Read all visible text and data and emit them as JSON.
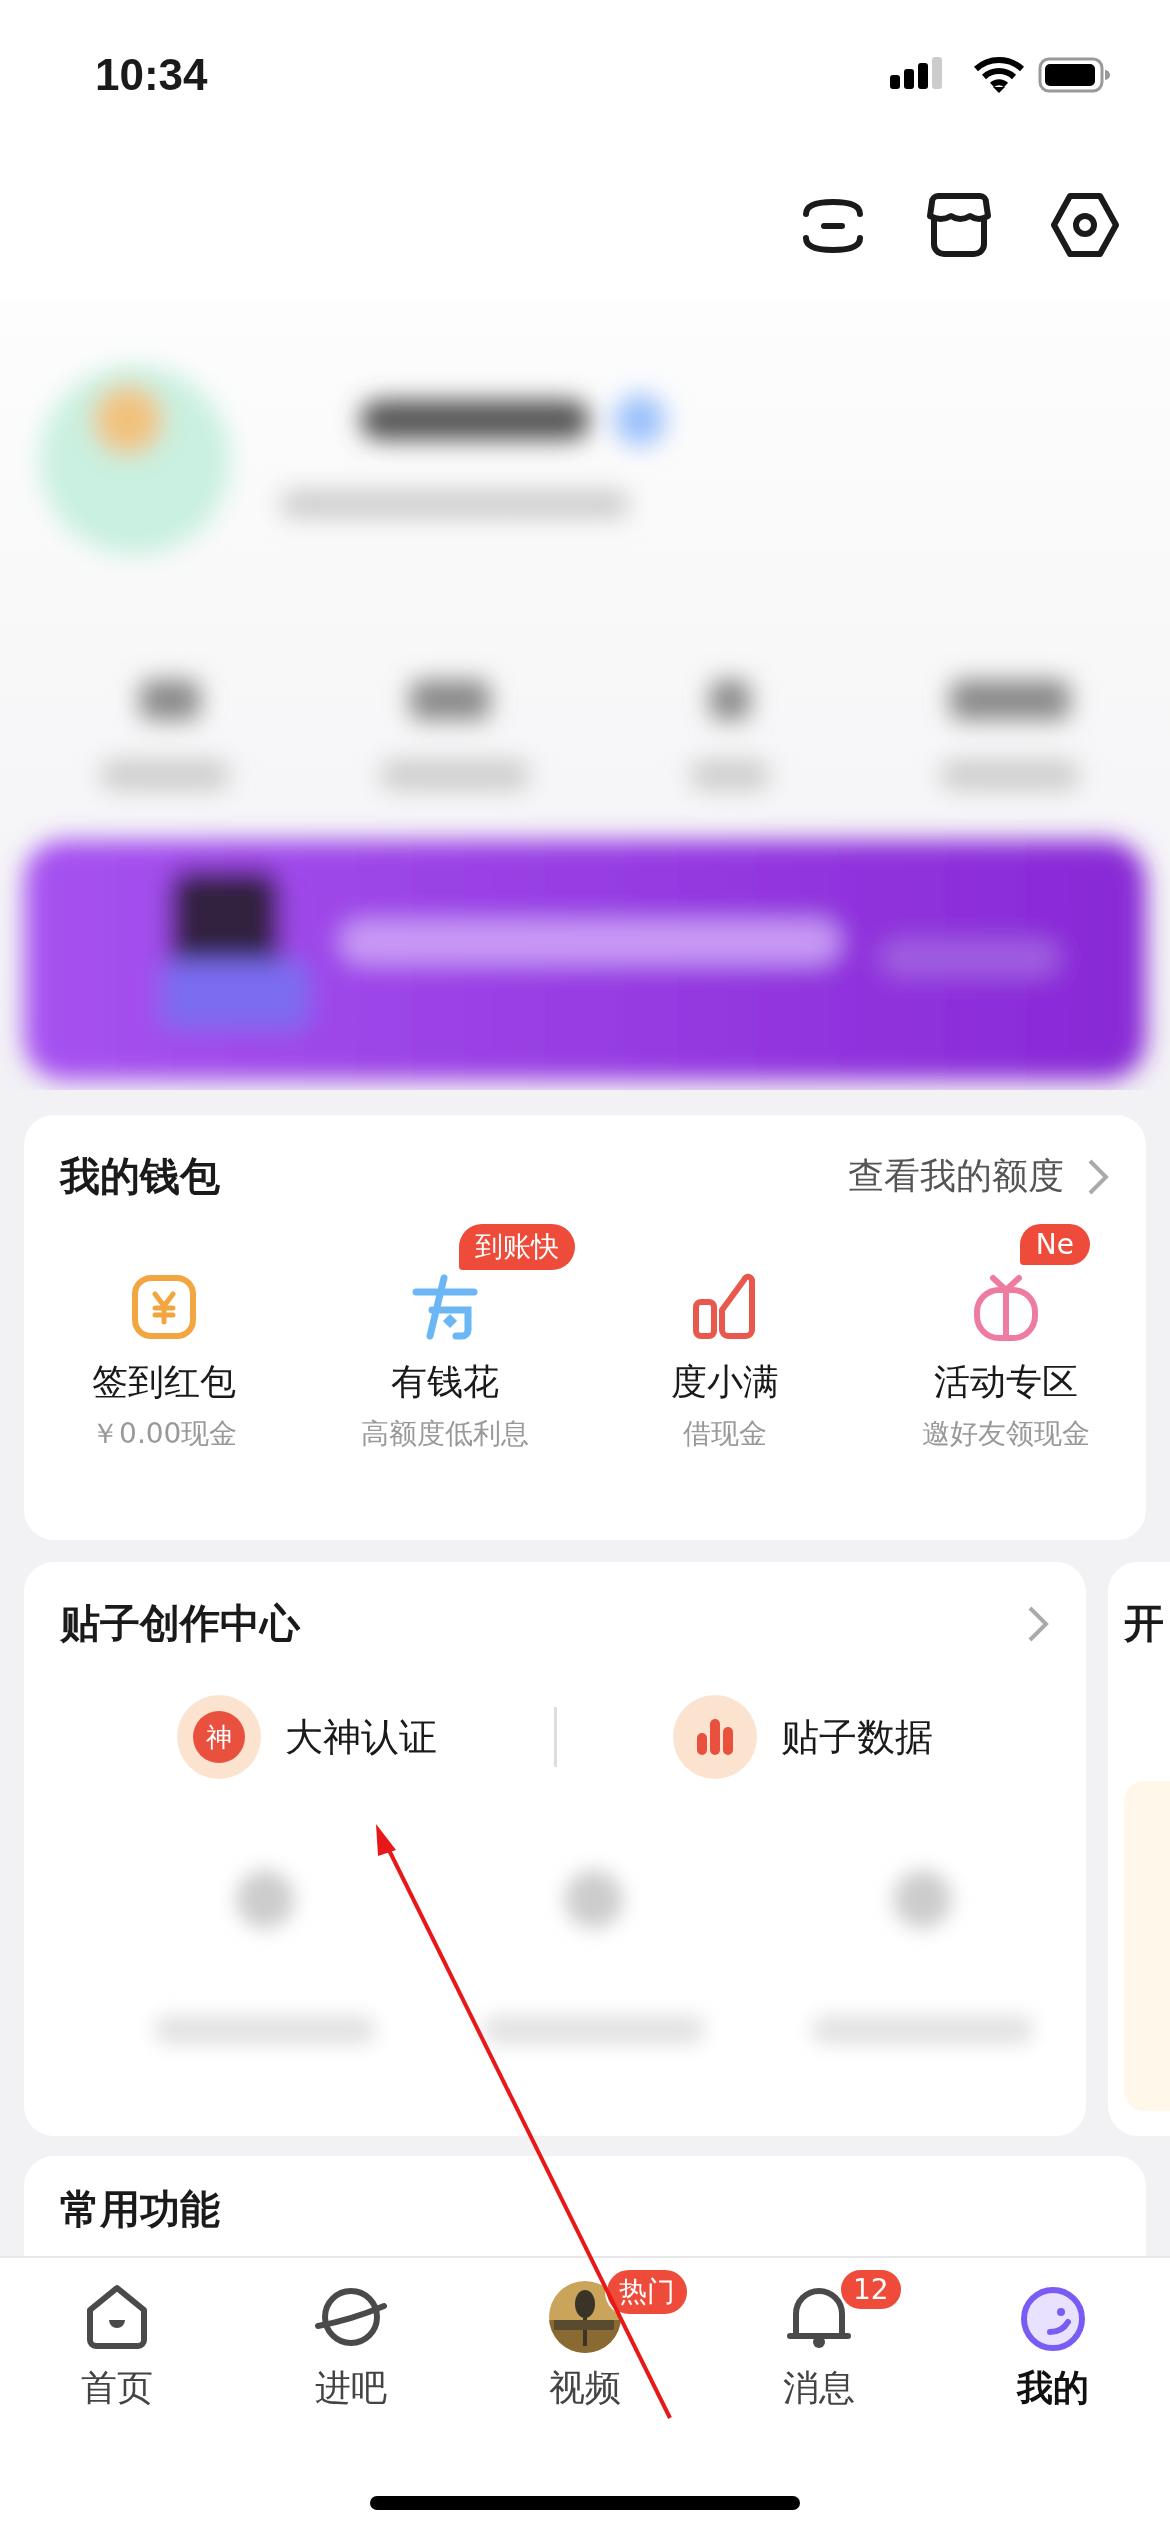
{
  "status_bar": {
    "time": "10:34"
  },
  "wallet": {
    "title": "我的钱包",
    "link": "查看我的额度",
    "items": [
      {
        "label": "签到红包",
        "sub": "￥0.00现金",
        "kind": "coin"
      },
      {
        "label": "有钱花",
        "sub": "高额度低利息",
        "kind": "loan",
        "badge": "到账快"
      },
      {
        "label": "度小满",
        "sub": "借现金",
        "kind": "finance"
      },
      {
        "label": "活动专区",
        "sub": "邀好友领现金",
        "kind": "event",
        "badge": "Ne"
      }
    ]
  },
  "creator": {
    "title": "贴子创作中心",
    "entries": [
      {
        "label": "大神认证",
        "kind": "seal",
        "icon_text": "神"
      },
      {
        "label": "贴子数据",
        "kind": "stats"
      }
    ]
  },
  "next_card": {
    "title": "开"
  },
  "common": {
    "title": "常用功能"
  },
  "nav": [
    {
      "label": "首页",
      "kind": "home",
      "selected": false
    },
    {
      "label": "进吧",
      "kind": "forum",
      "selected": false
    },
    {
      "label": "视频",
      "kind": "video",
      "selected": false,
      "badge": "热门"
    },
    {
      "label": "消息",
      "kind": "messages",
      "selected": false,
      "badge": "12"
    },
    {
      "label": "我的",
      "kind": "profile",
      "selected": true
    }
  ]
}
